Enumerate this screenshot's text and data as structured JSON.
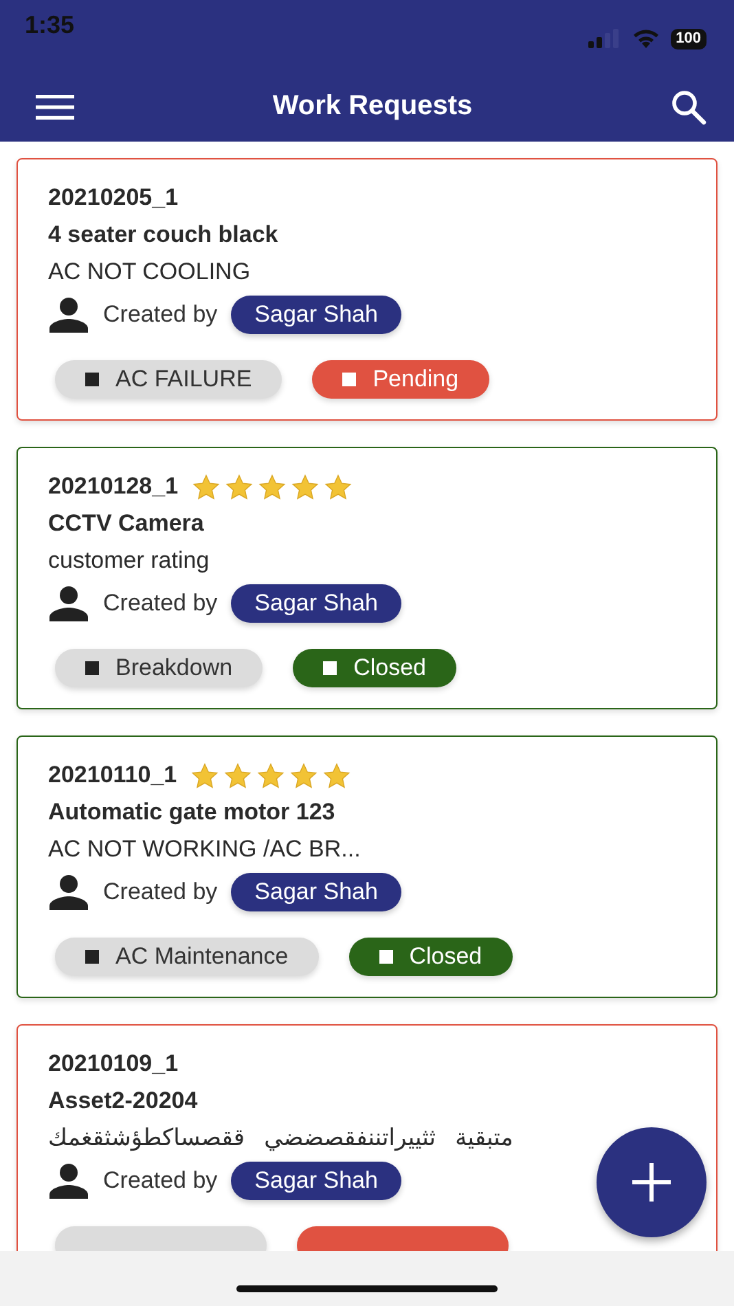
{
  "status_bar": {
    "time": "1:35",
    "battery": "100"
  },
  "header": {
    "title": "Work Requests"
  },
  "requests": [
    {
      "id": "20210205_1",
      "title": "4 seater couch black",
      "description": "AC NOT COOLING",
      "created_label": "Created by",
      "creator": "Sagar Shah",
      "category": "AC FAILURE",
      "status": {
        "kind": "pending",
        "label": "Pending"
      }
    },
    {
      "id": "20210128_1",
      "stars": 5,
      "title": "CCTV Camera",
      "description": "customer rating",
      "created_label": "Created by",
      "creator": "Sagar Shah",
      "category": "Breakdown",
      "status": {
        "kind": "closed",
        "label": "Closed"
      }
    },
    {
      "id": "20210110_1",
      "stars": 5,
      "title": "Automatic gate motor 123",
      "description": "AC NOT WORKING /AC BR...",
      "created_label": "Created by",
      "creator": "Sagar Shah",
      "category": "AC Maintenance",
      "status": {
        "kind": "closed",
        "label": "Closed"
      }
    },
    {
      "id": "20210109_1",
      "title": "Asset2-20204",
      "description": "متبقية   ثثييراتننفقصضضي   ققصساكطؤشثقغمك",
      "created_label": "Created by",
      "creator": "Sagar Shah",
      "status": {
        "kind": "pending"
      }
    }
  ]
}
